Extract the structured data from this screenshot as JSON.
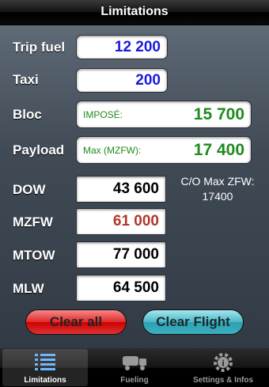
{
  "header": {
    "title": "Limitations"
  },
  "fields": {
    "trip_fuel": {
      "label": "Trip fuel",
      "value": "12 200",
      "color": "#1a1adb"
    },
    "taxi": {
      "label": "Taxi",
      "value": "200",
      "color": "#1a1adb"
    },
    "bloc": {
      "label": "Bloc",
      "prefix": "IMPOSÉ:",
      "value": "15 700",
      "color": "#1f8a1f"
    },
    "payload": {
      "label": "Payload",
      "prefix": "Max (MZFW):",
      "value": "17 400",
      "color": "#1f8a1f"
    },
    "dow": {
      "label": "DOW",
      "value": "43 600",
      "color": "#000000"
    },
    "mzfw": {
      "label": "MZFW",
      "value": "61 000",
      "color": "#b3362a"
    },
    "mtow": {
      "label": "MTOW",
      "value": "77 000",
      "color": "#000000"
    },
    "mlw": {
      "label": "MLW",
      "value": "64 500",
      "color": "#000000"
    }
  },
  "note": {
    "line1": "C/O Max ZFW:",
    "line2": "17400"
  },
  "buttons": {
    "clear_all": "Clear all",
    "clear_flight": "Clear Flight"
  },
  "tabs": [
    {
      "label": "Limitations",
      "icon": "list-icon",
      "active": true
    },
    {
      "label": "Fueling",
      "icon": "fuel-truck-icon",
      "active": false
    },
    {
      "label": "Settings & Infos",
      "icon": "gear-info-icon",
      "active": false
    }
  ]
}
